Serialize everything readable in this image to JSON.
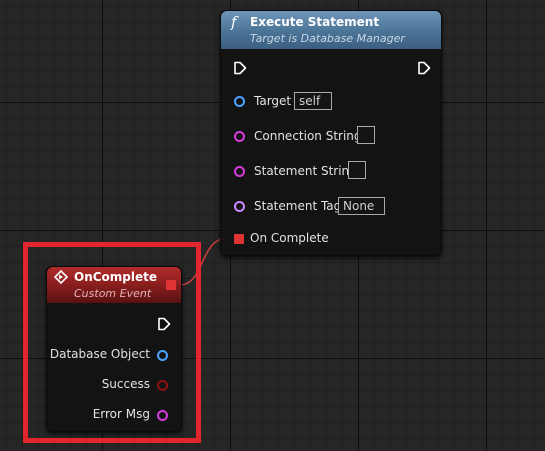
{
  "execute_statement": {
    "title": "Execute Statement",
    "subtitle": "Target is Database Manager",
    "icon": "function-icon",
    "pins": {
      "target": {
        "label": "Target",
        "default": "self",
        "color": "#4aa3ff"
      },
      "connection_string": {
        "label": "Connection String",
        "default": "",
        "color": "#d63bdb"
      },
      "statement_string": {
        "label": "Statement String",
        "default": "",
        "color": "#d63bdb"
      },
      "statement_tag": {
        "label": "Statement Tag",
        "default": "None",
        "color": "#c989ff"
      },
      "on_complete": {
        "label": "On Complete",
        "color": "#e03434"
      }
    }
  },
  "on_complete_event": {
    "title": "OnComplete",
    "subtitle": "Custom Event",
    "icon": "event-icon",
    "pins": {
      "database_object": {
        "label": "Database Object",
        "color": "#4aa3ff"
      },
      "success": {
        "label": "Success",
        "color": "#8f1212"
      },
      "error_msg": {
        "label": "Error Msg",
        "color": "#d63bdb"
      }
    }
  },
  "colors": {
    "highlight": "#e2262f",
    "function_header": "#4a7396",
    "event_header": "#8e1f1f",
    "wire": "#c43e3e"
  }
}
